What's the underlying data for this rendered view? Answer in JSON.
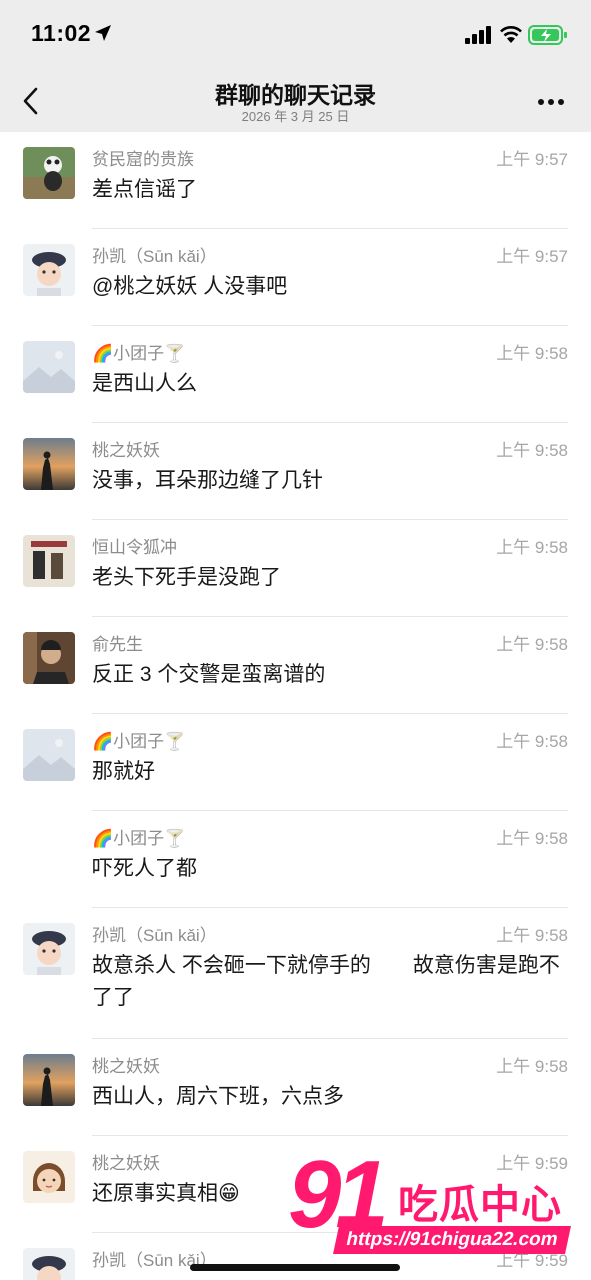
{
  "status_bar": {
    "time": "11:02"
  },
  "header": {
    "title": "群聊的聊天记录",
    "date": "2026 年 3 月 25 日"
  },
  "messages": [
    {
      "sender": "贫民窟的贵族",
      "time": "上午 9:57",
      "text": "差点信谣了",
      "avatar": "panda-photo"
    },
    {
      "sender": "孙凯（Sūn kǎi）",
      "time": "上午 9:57",
      "text": "@桃之妖妖 人没事吧",
      "avatar": "baby-photo"
    },
    {
      "sender": "🌈小团子🍸",
      "time": "上午 9:58",
      "text": "是西山人么",
      "avatar": "placeholder-image"
    },
    {
      "sender": "桃之妖妖",
      "time": "上午 9:58",
      "text": "没事，耳朵那边缝了几针",
      "avatar": "sunset-photo"
    },
    {
      "sender": "恒山令狐冲",
      "time": "上午 9:58",
      "text": "老头下死手是没跑了",
      "avatar": "poster-photo"
    },
    {
      "sender": "俞先生",
      "time": "上午 9:58",
      "text": "反正 3 个交警是蛮离谱的",
      "avatar": "man-photo"
    },
    {
      "sender": "🌈小团子🍸",
      "time": "上午 9:58",
      "text": "那就好",
      "avatar": "placeholder-image"
    },
    {
      "sender": "🌈小团子🍸",
      "time": "上午 9:58",
      "text": "吓死人了都",
      "avatar": ""
    },
    {
      "sender": "孙凯（Sūn kǎi）",
      "time": "上午 9:58",
      "text": "故意杀人 不会砸一下就停手的　　故意伤害是跑不了了",
      "avatar": "baby-photo"
    },
    {
      "sender": "桃之妖妖",
      "time": "上午 9:58",
      "text": "西山人，周六下班，六点多",
      "avatar": "sunset-photo"
    },
    {
      "sender": "桃之妖妖",
      "time": "上午 9:59",
      "text": "还原事实真相😁",
      "avatar": "cartoon-girl"
    },
    {
      "sender": "孙凯（Sūn kǎi）",
      "time": "上午 9:59",
      "text": "",
      "avatar": "baby-photo"
    }
  ],
  "watermark": {
    "number": "91",
    "name": "吃瓜中心",
    "url": "https://91chigua22.com"
  },
  "colors": {
    "header_bg": "#ededed",
    "watermark": "#ff1a70",
    "battery": "#34c759"
  }
}
